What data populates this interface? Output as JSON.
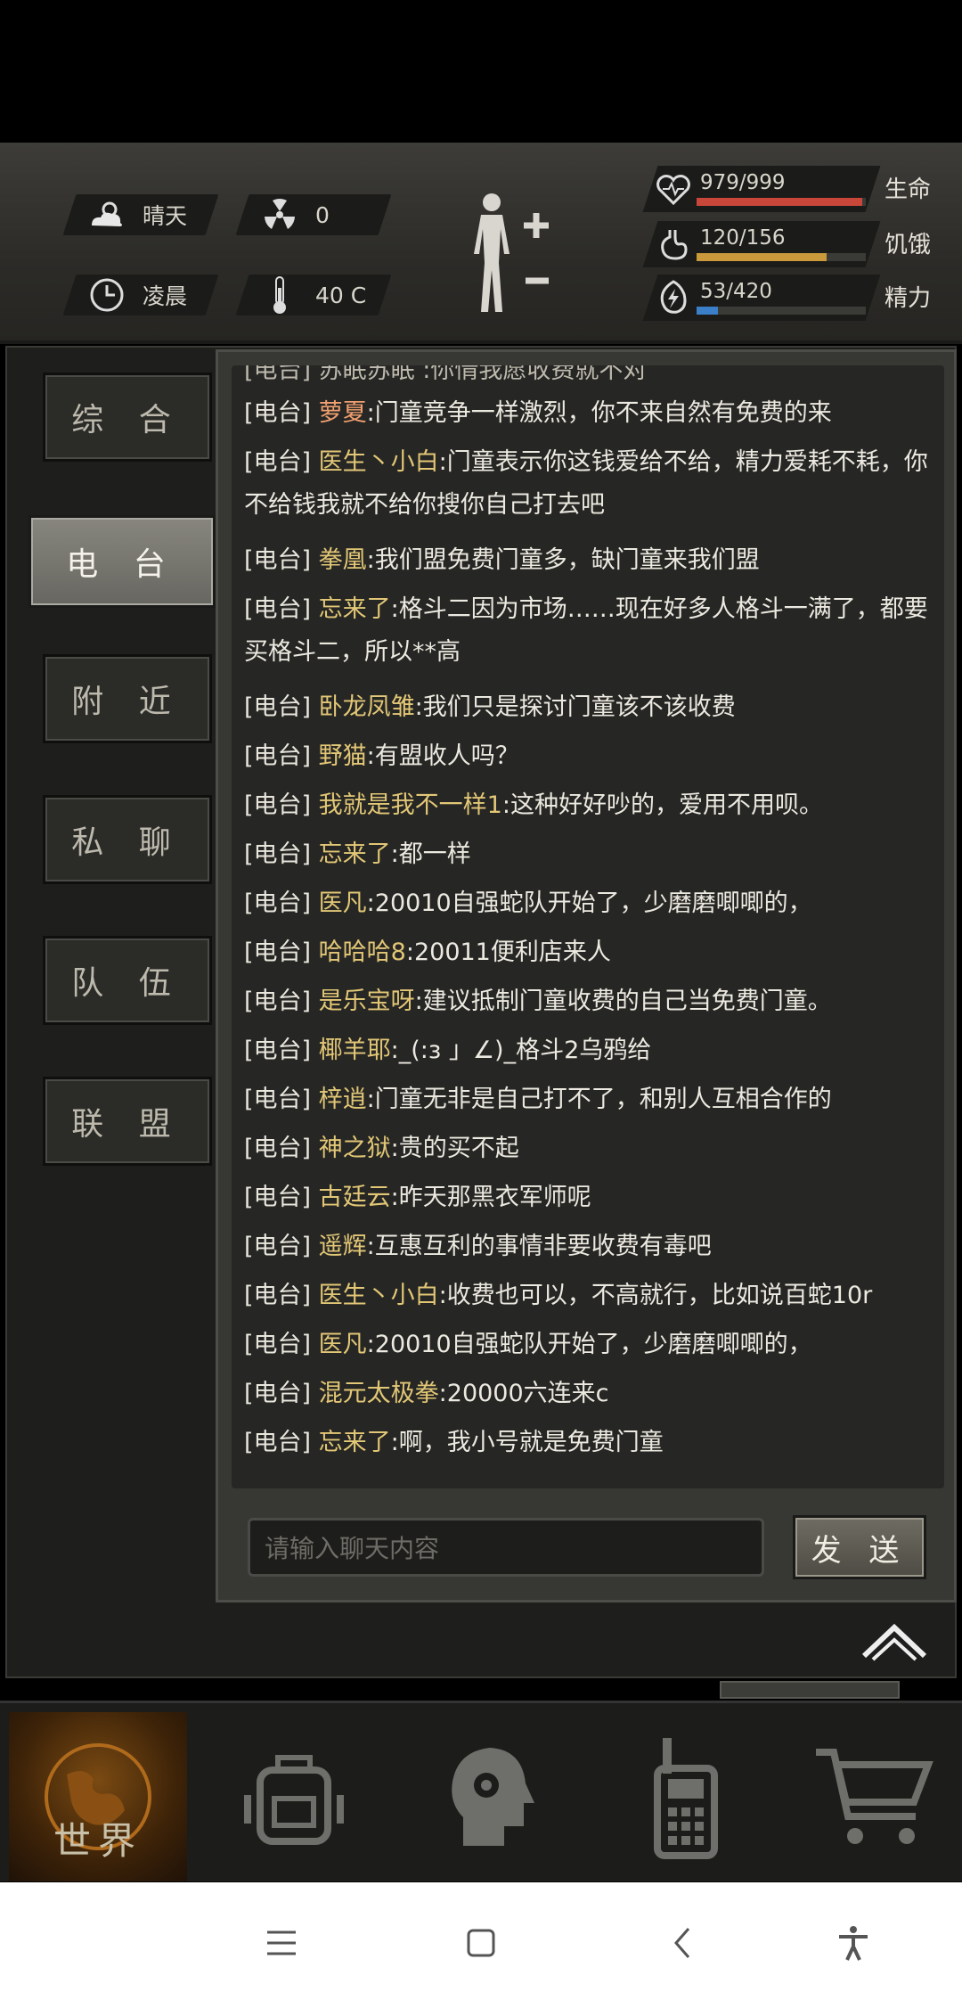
{
  "status": {
    "weather": "晴天",
    "radiation": "0",
    "time_of_day": "凌晨",
    "temperature": "40 C"
  },
  "vitals": [
    {
      "value": "979/999",
      "label": "生命",
      "ratio": 0.98,
      "color": "#c9463b"
    },
    {
      "value": "120/156",
      "label": "饥饿",
      "ratio": 0.77,
      "color": "#c9993b"
    },
    {
      "value": "53/420",
      "label": "精力",
      "ratio": 0.126,
      "color": "#3b7fc9"
    }
  ],
  "tabs": [
    "综 合",
    "电 台",
    "附 近",
    "私 聊",
    "队 伍",
    "联 盟"
  ],
  "active_tab": 1,
  "chat": {
    "partial_first": "[电台] 苏眠苏眠 :你情我愿收费就不对",
    "messages": [
      {
        "channel": "[电台]",
        "name": "萝夏",
        "text": ":门童竞争一样激烈，你不来自然有免费的来",
        "lines": 1,
        "red": true
      },
      {
        "channel": "[电台]",
        "name": "医生丶小白",
        "text": ":门童表示你这钱爱给不给，精力爱耗不耗，你不给钱我就不给你搜你自己打去吧",
        "lines": 2
      },
      {
        "channel": "[电台]",
        "name": "拳凰",
        "text": ":我们盟免费门童多，缺门童来我们盟",
        "lines": 1
      },
      {
        "channel": "[电台]",
        "name": "忘来了",
        "text": ":格斗二因为市场……现在好多人格斗一满了，都要买格斗二，所以**高",
        "lines": 2
      },
      {
        "channel": "[电台]",
        "name": "卧龙凤雏",
        "text": ":我们只是探讨门童该不该收费",
        "lines": 1
      },
      {
        "channel": "[电台]",
        "name": "野猫",
        "text": ":有盟收人吗？",
        "lines": 1
      },
      {
        "channel": "[电台]",
        "name": "我就是我不一样1",
        "text": ":这种好好吵的，爱用不用呗。",
        "lines": 1
      },
      {
        "channel": "[电台]",
        "name": "忘来了",
        "text": ":都一样",
        "lines": 1
      },
      {
        "channel": "[电台]",
        "name": "医凡",
        "text": ":20010自强蛇队开始了，少磨磨唧唧的，",
        "lines": 1
      },
      {
        "channel": "[电台]",
        "name": "哈哈哈8",
        "text": ":20011便利店来人",
        "lines": 1
      },
      {
        "channel": "[电台]",
        "name": "是乐宝呀",
        "text": ":建议抵制门童收费的自己当免费门童。",
        "lines": 1
      },
      {
        "channel": "[电台]",
        "name": "椰羊耶",
        "text": ":_(:з 」∠)_格斗2乌鸦给",
        "lines": 1
      },
      {
        "channel": "[电台]",
        "name": "梓逍",
        "text": ":门童无非是自己打不了，和别人互相合作的",
        "lines": 1
      },
      {
        "channel": "[电台]",
        "name": "神之狱",
        "text": ":贵的买不起",
        "lines": 1
      },
      {
        "channel": "[电台]",
        "name": "古廷云",
        "text": ":昨天那黑衣军师呢",
        "lines": 1
      },
      {
        "channel": "[电台]",
        "name": "遥辉",
        "text": ":互惠互利的事情非要收费有毒吧",
        "lines": 1
      },
      {
        "channel": "[电台]",
        "name": "医生丶小白",
        "text": ":收费也可以，不高就行，比如说百蛇10r",
        "lines": 1
      },
      {
        "channel": "[电台]",
        "name": "医凡",
        "text": ":20010自强蛇队开始了，少磨磨唧唧的，",
        "lines": 1
      },
      {
        "channel": "[电台]",
        "name": "混元太极拳",
        "text": ":20000六连来c",
        "lines": 1
      },
      {
        "channel": "[电台]",
        "name": "忘来了",
        "text": ":啊，我小号就是免费门童",
        "lines": 1
      }
    ]
  },
  "input": {
    "placeholder": "请输入聊天内容"
  },
  "send_label": "发 送",
  "bottom_nav": {
    "world_label": "世界"
  },
  "icons": [
    "sun-cloud-icon",
    "radiation-icon",
    "clock-icon",
    "thermometer-icon",
    "body-icon",
    "heart-icon",
    "stomach-icon",
    "energy-icon",
    "collapse-icon",
    "globe-icon",
    "backpack-icon",
    "skills-icon",
    "radio-icon",
    "cart-icon",
    "menu-icon",
    "home-icon",
    "back-icon",
    "accessibility-icon"
  ]
}
